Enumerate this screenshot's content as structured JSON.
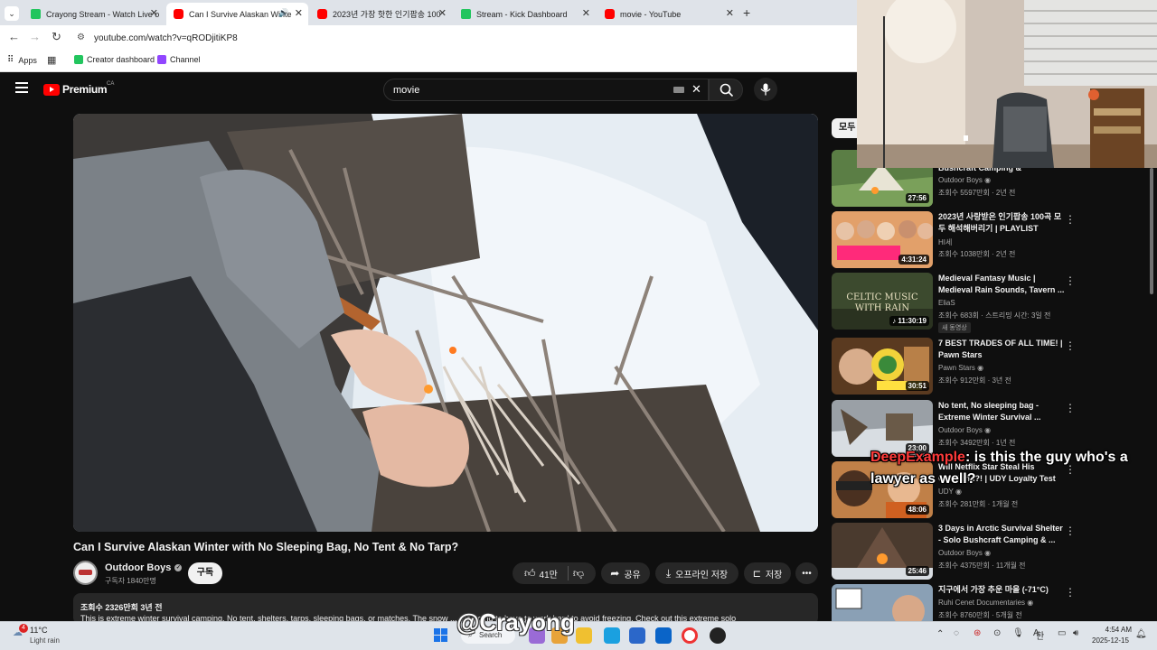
{
  "tabs": [
    {
      "title": "Crayong Stream - Watch Live o",
      "favicon": "kick-icon"
    },
    {
      "title": "Can I Survive Alaskan Winte",
      "favicon": "youtube-icon"
    },
    {
      "title": "2023년 가장 핫한 인기팝송 100",
      "favicon": "youtube-icon"
    },
    {
      "title": "Stream - Kick Dashboard",
      "favicon": "kick-icon"
    },
    {
      "title": "movie - YouTube",
      "favicon": "youtube-icon"
    }
  ],
  "address": "youtube.com/watch?v=qRODjitiKP8",
  "bookmarks": {
    "apps": "Apps",
    "creator": "Creator dashboard",
    "channel": "Channel"
  },
  "yt": {
    "logo": "Premium",
    "region": "CA",
    "search_value": "movie",
    "filter_chip": "모두"
  },
  "video": {
    "title": "Can I Survive Alaskan Winter with No Sleeping Bag, No Tent & No Tarp?",
    "channel": "Outdoor Boys",
    "subscribers": "구독자 1840만명",
    "subscribe": "구독",
    "likes": "41만",
    "share": "공유",
    "offline": "오프라인 저장",
    "save": "저장",
    "views_date": "조회수 2326만회  3년 전",
    "description": "This is extreme winter survival camping. No tent, shelters, tarps, sleeping bags, or matches. The snow ... are going to have to work hard to avoid freezing. Check out this extreme solo"
  },
  "recommendations": [
    {
      "title": "Bushcraft Camping & Foraging...",
      "channel": "Outdoor Boys",
      "stats": "조회수 5597만회 · 2년 전",
      "duration": "27:56",
      "verified": true,
      "thumb_color": "#4a6b3a"
    },
    {
      "title": "2023년 사랑받은 인기팝송 100곡 모두 해석해버리기 | PLAYLIST",
      "channel": "HI세",
      "stats": "조회수 1038만회 · 2년 전",
      "duration": "4:31:24",
      "verified": false,
      "thumb_color": "#c8a060"
    },
    {
      "title": "Medieval Fantasy Music | Medieval Rain Sounds, Tavern ...",
      "channel": "EliaS",
      "stats": "조회수 683회 · 스트리밍 시간: 3일 전",
      "duration": "11:30:19",
      "verified": false,
      "badge": "새 동영상",
      "thumb_color": "#3a4a30"
    },
    {
      "title": "7 BEST TRADES OF ALL TIME! | Pawn Stars",
      "channel": "Pawn Stars",
      "stats": "조회수 912만회 · 3년 전",
      "duration": "30:51",
      "verified": true,
      "thumb_color": "#7a5a2a"
    },
    {
      "title": "No tent, No sleeping bag - Extreme Winter Survival ...",
      "channel": "Outdoor Boys",
      "stats": "조회수 3492만회 · 1년 전",
      "duration": "23:00",
      "verified": true,
      "thumb_color": "#8a8e92"
    },
    {
      "title": "Will Netflix Star Steal His Girlfriend?! | UDY Loyalty Test",
      "channel": "UDY",
      "stats": "조회수 281만회 · 1개월 전",
      "duration": "48:06",
      "verified": true,
      "thumb_color": "#a07040"
    },
    {
      "title": "3 Days in Arctic Survival Shelter - Solo Bushcraft Camping & ...",
      "channel": "Outdoor Boys",
      "stats": "조회수 4375만회 · 11개월 전",
      "duration": "25:46",
      "verified": true,
      "thumb_color": "#5a4030"
    },
    {
      "title": "지구에서 가장 추운 마을 (-71°C)",
      "channel": "Ruhi Cenet Documentaries",
      "stats": "조회수 8760만회 · 5개월 전",
      "duration": "",
      "verified": true,
      "thumb_color": "#7a8ea0"
    }
  ],
  "chat": {
    "user": "DeepExample",
    "message": ": is this the guy who's a lawyer as well?"
  },
  "watermark": "@Crayong",
  "taskbar": {
    "temp": "11°C",
    "weather": "Light rain",
    "search": "Search",
    "weather_badge": "4",
    "time": "4:54 AM",
    "date": "2025-12-15",
    "ime": "한",
    "ime2": "A"
  }
}
